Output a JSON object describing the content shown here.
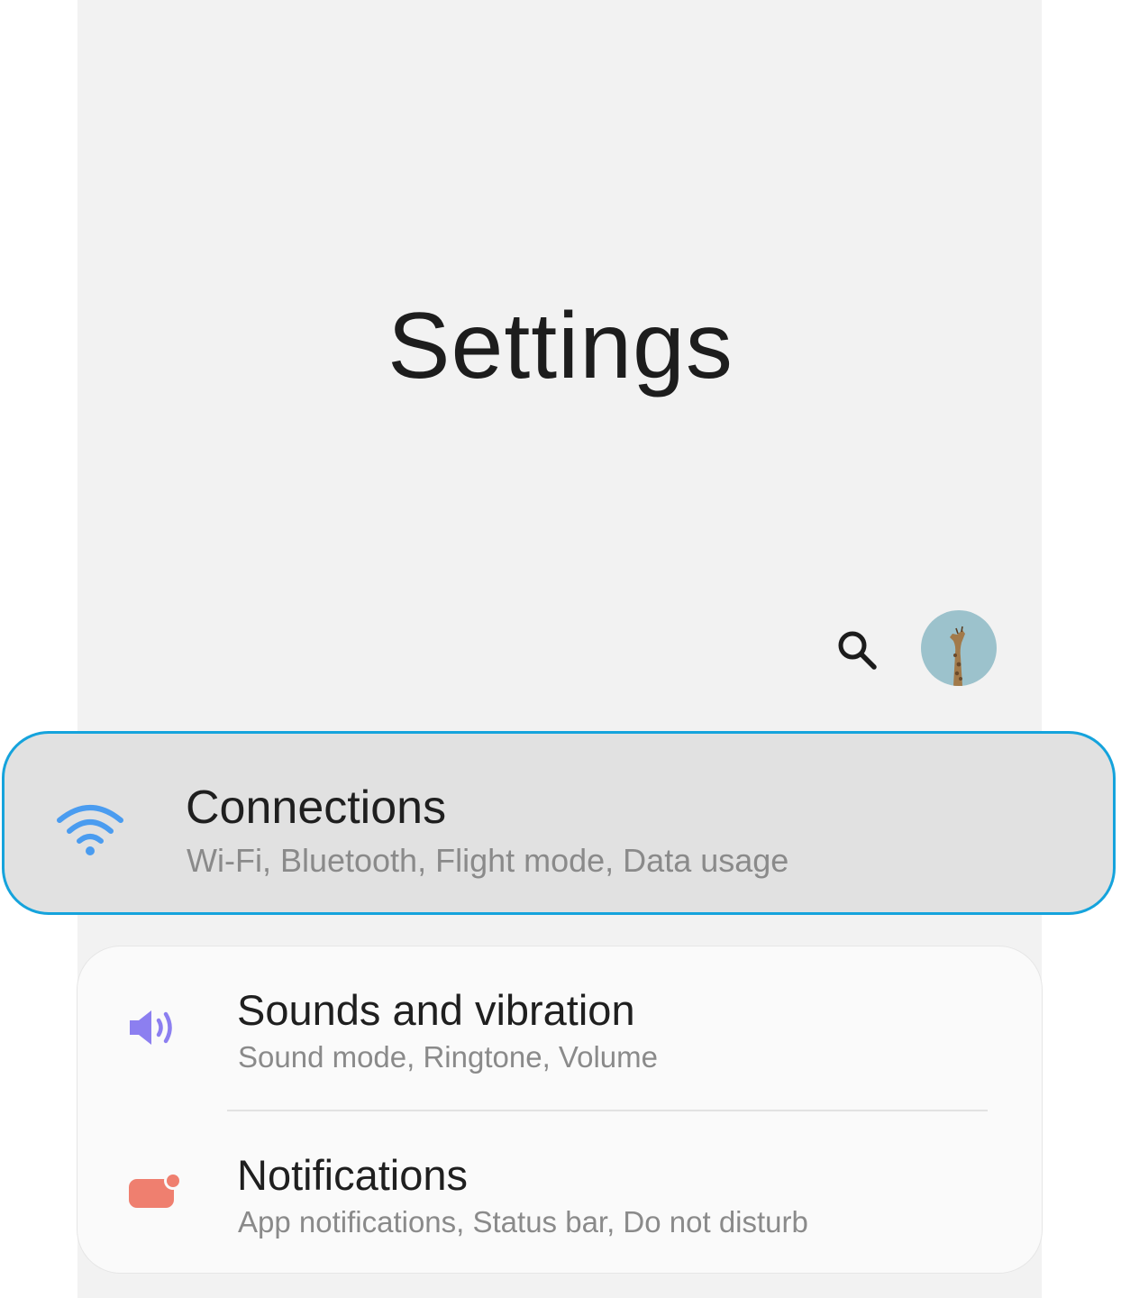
{
  "header": {
    "title": "Settings"
  },
  "toolbar": {
    "search_icon": "search-icon",
    "avatar_icon": "profile-avatar"
  },
  "items": [
    {
      "title": "Connections",
      "subtitle": "Wi-Fi, Bluetooth, Flight mode, Data usage",
      "icon": "wifi-icon",
      "icon_color": "#4a9cf0",
      "highlighted": true
    },
    {
      "title": "Sounds and vibration",
      "subtitle": "Sound mode, Ringtone, Volume",
      "icon": "volume-icon",
      "icon_color": "#8c7ff0"
    },
    {
      "title": "Notifications",
      "subtitle": "App notifications, Status bar, Do not disturb",
      "icon": "notification-icon",
      "icon_color": "#ef7f6f"
    }
  ],
  "colors": {
    "highlight_border": "#15a3dc",
    "background": "#f2f2f2"
  }
}
